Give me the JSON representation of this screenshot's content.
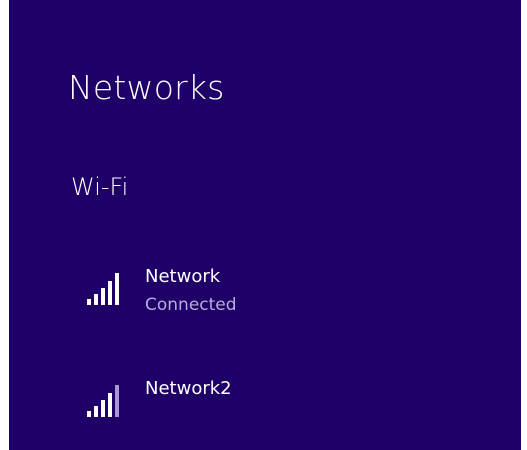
{
  "panel": {
    "title": "Networks",
    "section_label": "Wi-Fi"
  },
  "networks": [
    {
      "name": "Network",
      "status": "Connected",
      "signal_bars": 5,
      "signal_strength": 5,
      "icon": "wifi-signal-icon"
    },
    {
      "name": "Network2",
      "status": "",
      "signal_bars": 5,
      "signal_strength": 4,
      "icon": "wifi-signal-icon"
    }
  ],
  "colors": {
    "panel_background": "#1f0068",
    "primary_text": "#ffffff",
    "secondary_text": "#b8acd8",
    "signal_inactive": "#a996d2"
  }
}
